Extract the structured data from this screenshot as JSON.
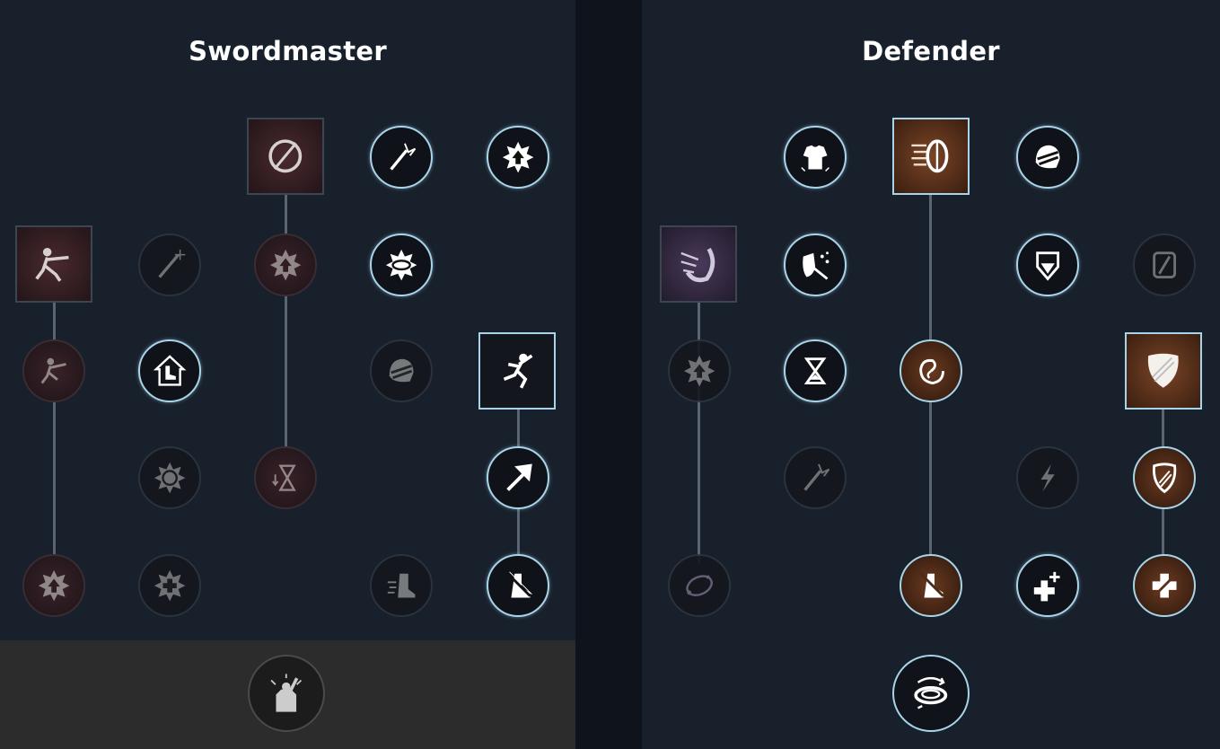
{
  "trees": [
    {
      "id": "swordmaster",
      "title": "Swordmaster"
    },
    {
      "id": "defender",
      "title": "Defender"
    }
  ],
  "icons": {
    "left": [
      "circle-slash-icon",
      "lightning-sword-icon",
      "star-up-icon",
      "lunge-strike-icon",
      "sword-sparkle-icon",
      "star-up-icon",
      "whirlwind-burst-icon",
      "lunge-strike-icon",
      "armored-boot-icon",
      "helmet-icon",
      "sprint-leap-icon",
      "burst-circle-icon",
      "hourglass-down-icon",
      "arrow-up-right-icon",
      "star-up-icon",
      "star-cross-icon",
      "speed-boot-icon",
      "boot-dash-icon",
      "fist-rally-icon"
    ],
    "right": [
      "armor-chest-icon",
      "shield-dash-icon",
      "helmet-icon",
      "spiral-blade-icon",
      "frost-shield-icon",
      "shield-down-icon",
      "slashed-shield-icon",
      "star-up-icon",
      "hourglass-icon",
      "vortex-icon",
      "crest-shield-icon",
      "lightning-sword-icon",
      "lightning-bolt-icon",
      "shield-slash-icon",
      "orbit-stars-icon",
      "boot-dash-icon",
      "double-plus-icon",
      "plus-slash-icon",
      "spin-ring-icon"
    ]
  },
  "colors": {
    "active_ring": "#a8d4ea",
    "panel_bg": "#18202c",
    "background": "#0f141c",
    "orange_fill": "#7a4526",
    "red_fill": "#4a2a2f",
    "purple_fill": "#4a3a5a",
    "bottom_strip": "#2c2c2c"
  }
}
